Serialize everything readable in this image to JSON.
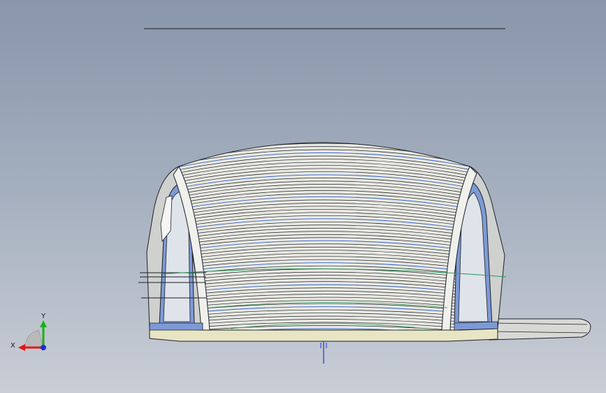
{
  "viewport": {
    "background_top": "#8996ab",
    "background_bottom": "#c9ced6"
  },
  "triad": {
    "x_label": "X",
    "y_label": "Y",
    "x_color": "#e01818",
    "y_color": "#17b317",
    "z_color": "#1b2fd6"
  },
  "model": {
    "edge_color": "#1e2126",
    "shell_color": "#e9e9e3",
    "section_curve_color": "#2c5fc9",
    "guide_curve_color": "#2a9a5a",
    "base_color": "#e8e5c4"
  }
}
